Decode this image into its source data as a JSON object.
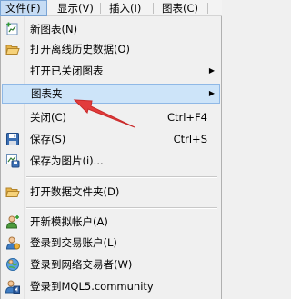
{
  "menubar": {
    "items": [
      {
        "label": "文件(F)",
        "active": true
      },
      {
        "label": "显示(V)"
      },
      {
        "label": "插入(I)"
      },
      {
        "label": "图表(C)"
      }
    ]
  },
  "menu": {
    "new_chart": {
      "label": "新图表(N)",
      "icon": "new-chart-icon"
    },
    "open_offline": {
      "label": "打开离线历史数据(O)",
      "icon": "open-folder-icon"
    },
    "open_closed": {
      "label": "打开已关闭图表"
    },
    "profiles": {
      "label": "图表夹"
    },
    "close": {
      "label": "关闭(C)",
      "shortcut": "Ctrl+F4"
    },
    "save": {
      "label": "保存(S)",
      "shortcut": "Ctrl+S",
      "icon": "save-icon"
    },
    "save_as_picture": {
      "label": "保存为图片(i)...",
      "icon": "picture-icon"
    },
    "open_data_folder": {
      "label": "打开数据文件夹(D)",
      "icon": "folder-icon"
    },
    "open_demo": {
      "label": "开新模拟帐户(A)",
      "icon": "user-add-icon"
    },
    "login_trade": {
      "label": "登录到交易账户(L)",
      "icon": "user-login-icon"
    },
    "login_web": {
      "label": "登录到网络交易者(W)",
      "icon": "web-trader-icon"
    },
    "login_mql5": {
      "label": "登录到MQL5.community",
      "icon": "mql5-icon"
    }
  },
  "colors": {
    "hover_bg": "#cde4f9",
    "annotation_arrow": "#e23c3c"
  }
}
